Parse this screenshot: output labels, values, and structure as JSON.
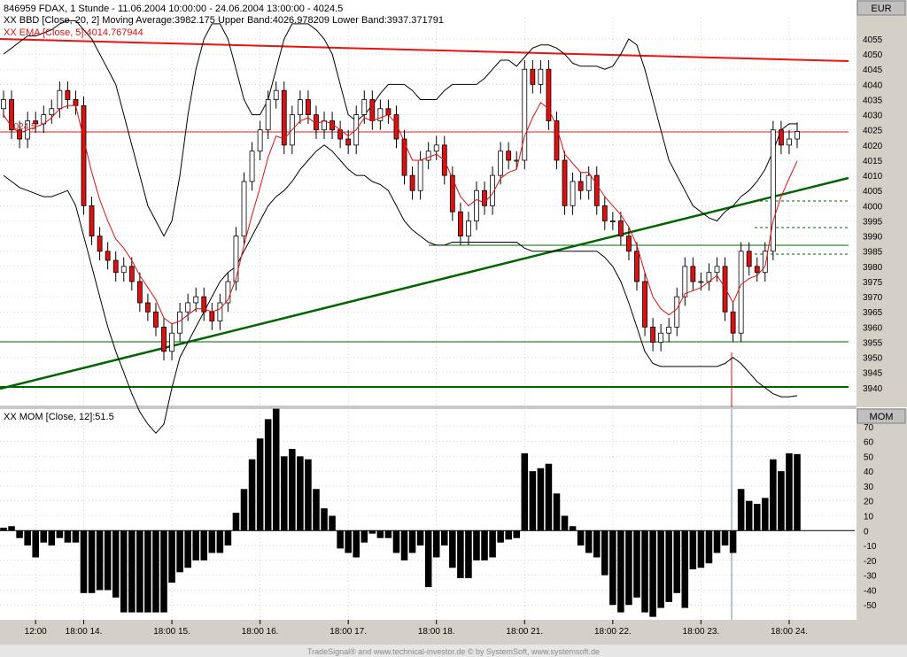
{
  "colors": {
    "candle_up": "#ffffff",
    "candle_down": "#dd1111",
    "ema": "#dd1111",
    "band": "#000000",
    "trend_red": "#ee1111",
    "trend_green": "#006400",
    "panel_bg": "#d4d0c8",
    "grid": "#b8b8b8"
  },
  "chart_data": [
    {
      "type": "candlestick",
      "title": "846959  FDAX, 1 Stunde - 11.06.2004 10:00:00 - 24.06.2004 13:00:00 - 4024.5",
      "indicator_labels": [
        "XX BBD [Close, 20, 2] Moving Average:3982.175 Upper Band:4026.978209 Lower Band:3937.371791",
        "XX EMA [Close, 5]:4014.767944"
      ],
      "currency_label": "EUR",
      "last_price_label": "4024.5",
      "ylim": [
        3935,
        4062
      ],
      "y_ticks": [
        3940,
        3945,
        3950,
        3955,
        3960,
        3965,
        3970,
        3975,
        3980,
        3985,
        3990,
        3995,
        4000,
        4005,
        4010,
        4015,
        4020,
        4025,
        4030,
        4035,
        4040,
        4045,
        4050,
        4055
      ],
      "x_ticks": [
        "12:00",
        "18:00 14.",
        "18:00 15.",
        "18:00 16.",
        "18:00 17.",
        "18:00 18.",
        "18:00 21.",
        "18:00 22.",
        "18:00 23.",
        "18:00 24."
      ],
      "x_tick_positions": [
        4,
        10,
        21,
        32,
        43,
        54,
        65,
        76,
        87,
        98
      ],
      "close": [
        4035,
        4025,
        4022,
        4028,
        4027,
        4030,
        4032,
        4038,
        4035,
        4033,
        4000,
        3990,
        3985,
        3982,
        3978,
        3980,
        3975,
        3968,
        3965,
        3960,
        3952,
        3958,
        3965,
        3968,
        3970,
        3965,
        3962,
        3968,
        3975,
        3990,
        4008,
        4018,
        4025,
        4035,
        4038,
        4020,
        4030,
        4035,
        4030,
        4025,
        4028,
        4025,
        4022,
        4020,
        4030,
        4035,
        4028,
        4032,
        4030,
        4022,
        4010,
        4005,
        4015,
        4018,
        4020,
        4010,
        3998,
        3990,
        3995,
        4005,
        4000,
        4010,
        4018,
        4015,
        4015,
        4045,
        4040,
        4045,
        4028,
        4015,
        4000,
        4008,
        4005,
        4010,
        4000,
        3995,
        3995,
        3990,
        3985,
        3975,
        3960,
        3955,
        3958,
        3960,
        3970,
        3980,
        3975,
        3975,
        3978,
        3980,
        3965,
        3958,
        3985,
        3980,
        3978,
        3985,
        4025,
        4020,
        4022,
        4024.5
      ],
      "ema": [
        4030,
        4026,
        4024,
        4025,
        4026,
        4027,
        4029,
        4032,
        4033,
        4033,
        4022,
        4011,
        4002,
        3995,
        3989,
        3986,
        3982,
        3977,
        3973,
        3969,
        3963,
        3961,
        3962,
        3964,
        3966,
        3966,
        3965,
        3966,
        3969,
        3976,
        3987,
        3997,
        4006,
        4016,
        4023,
        4022,
        4025,
        4028,
        4029,
        4027,
        4028,
        4027,
        4025,
        4023,
        4025,
        4029,
        4028,
        4029,
        4030,
        4027,
        4021,
        4015,
        4015,
        4016,
        4017,
        4015,
        4009,
        4003,
        4000,
        4002,
        4001,
        4004,
        4009,
        4011,
        4012,
        4023,
        4029,
        4034,
        4032,
        4026,
        4017,
        4014,
        4011,
        4011,
        4007,
        4003,
        4000,
        3997,
        3993,
        3987,
        3978,
        3970,
        3966,
        3964,
        3966,
        3971,
        3972,
        3973,
        3975,
        3977,
        3973,
        3968,
        3974,
        3976,
        3977,
        3980,
        3995,
        4003,
        4009,
        4014.77
      ],
      "bollinger_upper": [
        4050,
        4052,
        4054,
        4056,
        4056,
        4057,
        4058,
        4060,
        4061,
        4061,
        4058,
        4055,
        4050,
        4045,
        4040,
        4030,
        4020,
        4010,
        4000,
        3995,
        3990,
        3995,
        4010,
        4030,
        4045,
        4055,
        4060,
        4060,
        4055,
        4045,
        4035,
        4030,
        4030,
        4035,
        4045,
        4055,
        4060,
        4060,
        4060,
        4058,
        4055,
        4050,
        4040,
        4030,
        4028,
        4030,
        4033,
        4037,
        4040,
        4040,
        4040,
        4038,
        4035,
        4035,
        4035,
        4038,
        4040,
        4040,
        4040,
        4040,
        4042,
        4045,
        4048,
        4048,
        4046,
        4049,
        4052,
        4053,
        4053,
        4052,
        4050,
        4047,
        4046,
        4046,
        4046,
        4045,
        4046,
        4050,
        4055,
        4053,
        4045,
        4035,
        4025,
        4015,
        4010,
        4005,
        4000,
        3998,
        3996,
        3995,
        3998,
        4000,
        4003,
        4005,
        4008,
        4012,
        4018,
        4025,
        4027,
        4027
      ],
      "bollinger_lower": [
        4010,
        4008,
        4006,
        4005,
        4004,
        4003,
        4003,
        4004,
        4005,
        4000,
        3990,
        3980,
        3970,
        3960,
        3952,
        3945,
        3938,
        3932,
        3928,
        3925,
        3928,
        3940,
        3950,
        3955,
        3960,
        3965,
        3970,
        3975,
        3978,
        3980,
        3985,
        3990,
        3995,
        4000,
        4003,
        4005,
        4008,
        4012,
        4015,
        4018,
        4020,
        4018,
        4015,
        4012,
        4010,
        4010,
        4008,
        4007,
        4005,
        4000,
        3995,
        3992,
        3990,
        3988,
        3987,
        3987,
        3988,
        3988,
        3988,
        3988,
        3988,
        3988,
        3988,
        3988,
        3988,
        3986,
        3985,
        3985,
        3985,
        3985,
        3985,
        3985,
        3985,
        3985,
        3985,
        3983,
        3980,
        3975,
        3968,
        3960,
        3952,
        3948,
        3947,
        3947,
        3947,
        3947,
        3947,
        3947,
        3947,
        3947,
        3948,
        3950,
        3948,
        3945,
        3942,
        3940,
        3938,
        3937,
        3937,
        3937.37
      ],
      "momentum_panel": {
        "title": "XX MOM [Close, 12]:51.5",
        "currency_label": "MOM",
        "ylim": [
          -60,
          80
        ],
        "y_ticks": [
          -50,
          -40,
          -30,
          -20,
          -10,
          0,
          10,
          20,
          30,
          40,
          50,
          60,
          70
        ],
        "values": [
          2,
          3,
          -5,
          -10,
          -18,
          -8,
          -10,
          -5,
          -8,
          -8,
          -42,
          -42,
          -40,
          -40,
          -45,
          -55,
          -55,
          -55,
          -55,
          -55,
          -55,
          -35,
          -28,
          -25,
          -20,
          -20,
          -15,
          -15,
          -10,
          12,
          28,
          48,
          62,
          75,
          82,
          50,
          55,
          50,
          48,
          28,
          15,
          10,
          -12,
          -15,
          -18,
          -8,
          -2,
          -5,
          -5,
          -15,
          -20,
          -15,
          -10,
          -38,
          -18,
          -10,
          -25,
          -32,
          -32,
          -20,
          -20,
          -18,
          -8,
          -6,
          -5,
          52,
          40,
          42,
          45,
          25,
          10,
          3,
          -10,
          -15,
          -18,
          -30,
          -50,
          -55,
          -50,
          -45,
          -55,
          -58,
          -52,
          -48,
          -42,
          -52,
          -26,
          -25,
          -22,
          -15,
          -10,
          -15,
          28,
          20,
          18,
          22,
          48,
          40,
          52,
          51.5
        ]
      },
      "trend_lines_note": "two trend lines (red falling resistance, green rising support) and several horizontal support/resistance lines"
    }
  ],
  "footer": "TradeSignal® and www.technical-investor.de © by SystemSoft, www.systemsoft.de"
}
